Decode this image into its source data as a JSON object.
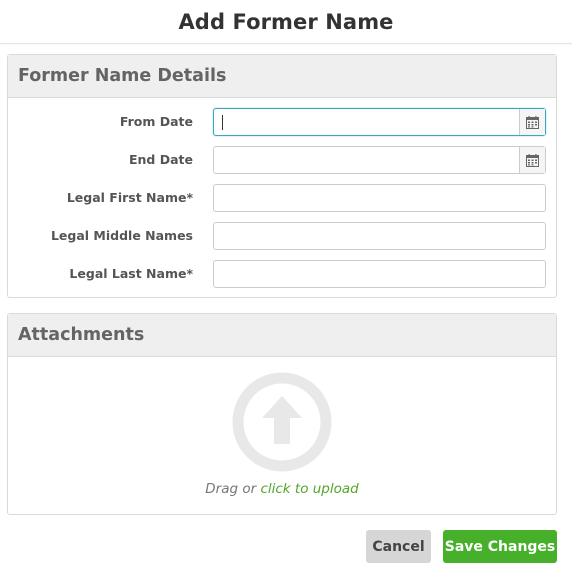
{
  "dialog": {
    "title": "Add Former Name"
  },
  "details": {
    "heading": "Former Name Details",
    "fields": [
      {
        "label": "From Date",
        "value": "",
        "placeholder": ""
      },
      {
        "label": "End Date",
        "value": "",
        "placeholder": ""
      },
      {
        "label": "Legal First Name*",
        "value": "",
        "placeholder": ""
      },
      {
        "label": "Legal Middle Names",
        "value": "",
        "placeholder": ""
      },
      {
        "label": "Legal Last Name*",
        "value": "",
        "placeholder": ""
      }
    ]
  },
  "attachments": {
    "heading": "Attachments",
    "icon": "upload-arrow-icon",
    "drag_text": "Drag or",
    "link_text": "click to upload"
  },
  "footer": {
    "cancel_label": "Cancel",
    "save_label": "Save Changes"
  },
  "colors": {
    "accent_green": "#46b02a",
    "link_green": "#53a62a",
    "focus_border": "#3aa6c4",
    "panel_header_bg": "#f0efef"
  }
}
